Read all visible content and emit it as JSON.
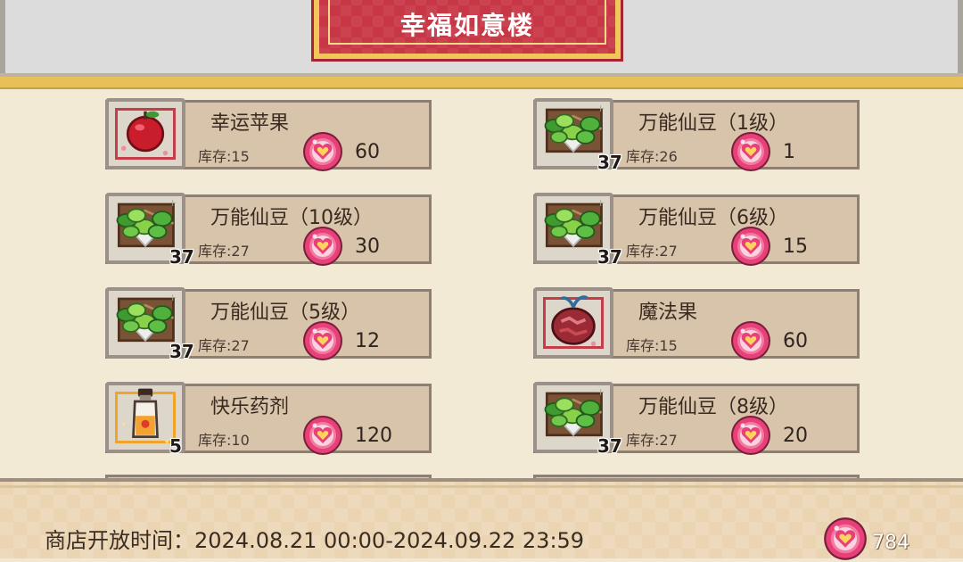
{
  "header": {
    "title": "幸福如意楼"
  },
  "items": [
    {
      "name": "幸运苹果",
      "stock": "库存:15",
      "price": "60",
      "qty": "",
      "icon": "apple-icon",
      "frame": "red"
    },
    {
      "name": "万能仙豆（1级）",
      "stock": "库存:26",
      "price": "1",
      "qty": "37",
      "icon": "beans-icon",
      "frame": "none"
    },
    {
      "name": "万能仙豆（10级）",
      "stock": "库存:27",
      "price": "30",
      "qty": "37",
      "icon": "beans-icon",
      "frame": "none"
    },
    {
      "name": "万能仙豆（6级）",
      "stock": "库存:27",
      "price": "15",
      "qty": "37",
      "icon": "beans-icon",
      "frame": "none"
    },
    {
      "name": "万能仙豆（5级）",
      "stock": "库存:27",
      "price": "12",
      "qty": "37",
      "icon": "beans-icon",
      "frame": "none"
    },
    {
      "name": "魔法果",
      "stock": "库存:15",
      "price": "60",
      "qty": "",
      "icon": "magic-fruit-icon",
      "frame": "red"
    },
    {
      "name": "快乐药剂",
      "stock": "库存:10",
      "price": "120",
      "qty": "5",
      "icon": "potion-icon",
      "frame": "gold"
    },
    {
      "name": "万能仙豆（8级）",
      "stock": "库存:27",
      "price": "20",
      "qty": "37",
      "icon": "beans-icon",
      "frame": "none"
    }
  ],
  "footer": {
    "open_time": "商店开放时间：2024.08.21 00:00-2024.09.22 23:59",
    "balance": "784"
  },
  "colors": {
    "banner": "#c83745",
    "banner_border": "#f3c55a",
    "currency": "#e8417a"
  }
}
